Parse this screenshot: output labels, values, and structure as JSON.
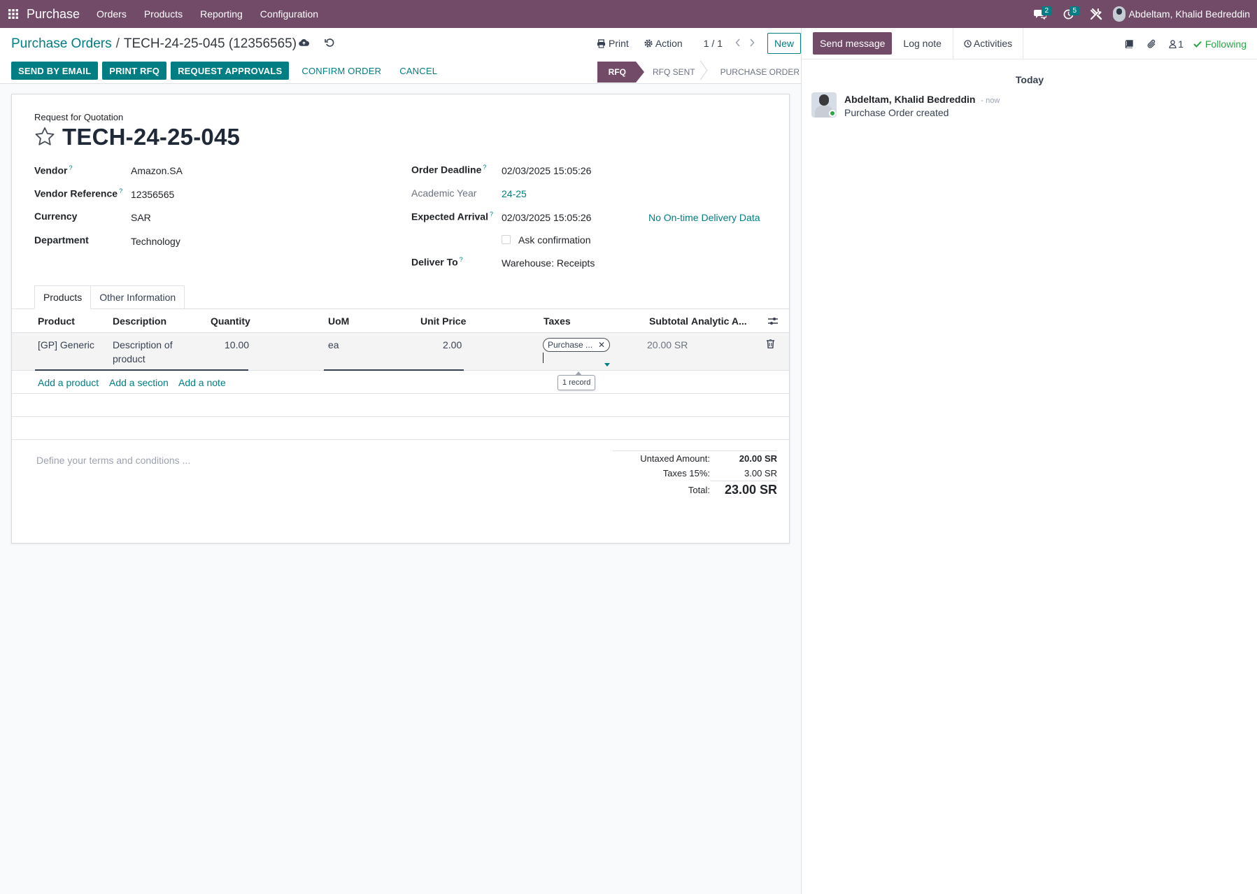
{
  "navbar": {
    "app_name": "Purchase",
    "menus": [
      "Orders",
      "Products",
      "Reporting",
      "Configuration"
    ],
    "messages_count": "2",
    "activities_count": "5",
    "user_name": "Abdeltam, Khalid Bedreddin"
  },
  "breadcrumb": {
    "parent": "Purchase Orders",
    "separator": "/",
    "current": "TECH-24-25-045 (12356565)"
  },
  "control": {
    "print_label": "Print",
    "action_label": "Action",
    "pager": "1 / 1",
    "new_label": "New"
  },
  "buttons": {
    "send_by_email": "SEND BY EMAIL",
    "print_rfq": "PRINT RFQ",
    "request_approvals": "REQUEST APPROVALS",
    "confirm_order": "CONFIRM ORDER",
    "cancel": "CANCEL"
  },
  "stages": [
    "RFQ",
    "RFQ SENT",
    "PURCHASE ORDER"
  ],
  "form": {
    "subtitle": "Request for Quotation",
    "title": "TECH-24-25-045",
    "left_fields": [
      {
        "label": "Vendor",
        "value": "Amazon.SA",
        "help": "?"
      },
      {
        "label": "Vendor Reference",
        "value": "12356565",
        "help": "?"
      },
      {
        "label": "Currency",
        "value": "SAR"
      },
      {
        "label": "Department",
        "value": "Technology"
      }
    ],
    "order_deadline": {
      "label": "Order Deadline",
      "value": "02/03/2025 15:05:26",
      "help": "?"
    },
    "academic_year": {
      "label": "Academic Year",
      "value": "24-25"
    },
    "expected_arrival": {
      "label": "Expected Arrival",
      "value": "02/03/2025 15:05:26",
      "help": "?",
      "extra": "No On-time Delivery Data"
    },
    "ask_confirmation": {
      "label": "Ask confirmation",
      "checked": false
    },
    "deliver_to": {
      "label": "Deliver To",
      "value": "Warehouse: Receipts",
      "help": "?"
    }
  },
  "tabs": [
    "Products",
    "Other Information"
  ],
  "table": {
    "columns": [
      "Product",
      "Description",
      "Quantity",
      "UoM",
      "Unit Price",
      "Taxes",
      "Subtotal",
      "Analytic A..."
    ],
    "rows": [
      {
        "product": "[GP] Generic I",
        "description_1": "Description of",
        "description_2": "product",
        "quantity": "10.00",
        "uom": "ea",
        "unit_price": "2.00",
        "tax_tag": "Purchase ...",
        "subtotal": "20.00 SR"
      }
    ],
    "tooltip": "1 record",
    "add_product": "Add a product",
    "add_section": "Add a section",
    "add_note": "Add a note"
  },
  "terms_placeholder": "Define your terms and conditions ...",
  "totals": {
    "untaxed_label": "Untaxed Amount:",
    "untaxed_value": "20.00 SR",
    "taxes_label": "Taxes 15%:",
    "taxes_value": "3.00 SR",
    "total_label": "Total:",
    "total_value": "23.00 SR"
  },
  "chatter": {
    "send_message": "Send message",
    "log_note": "Log note",
    "activities": "Activities",
    "followers_count": "1",
    "following": "Following",
    "date_separator": "Today",
    "messages": [
      {
        "author": "Abdeltam, Khalid Bedreddin",
        "when": "- now",
        "text": "Purchase Order created"
      }
    ]
  },
  "colors": {
    "brand": "#714b67",
    "accent": "#017e84",
    "success": "#28a745"
  }
}
